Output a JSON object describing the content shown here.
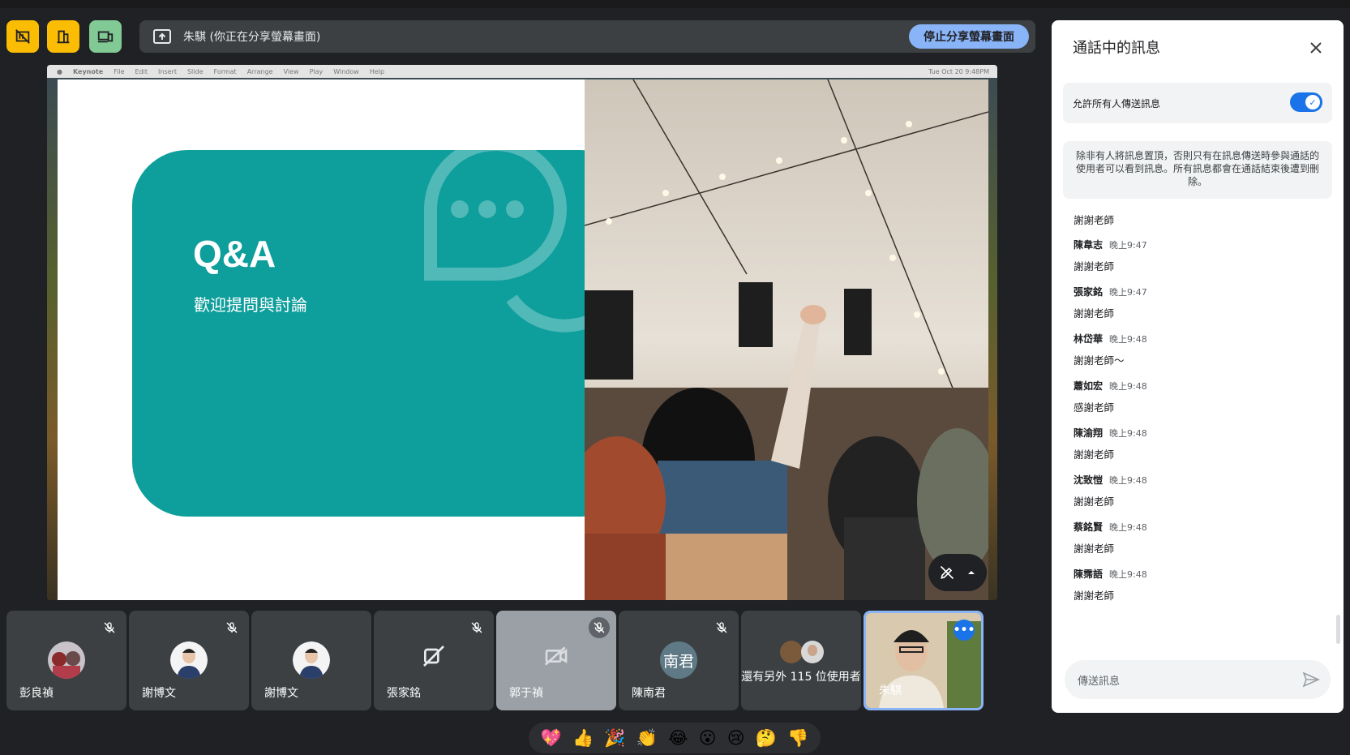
{
  "controls": {
    "share_status": "朱騏 (你正在分享螢幕畫面)",
    "stop_share_label": "停止分享螢幕畫面"
  },
  "presentation": {
    "menubar": [
      "Keynote",
      "File",
      "Edit",
      "Insert",
      "Slide",
      "Format",
      "Arrange",
      "View",
      "Play",
      "Window",
      "Help"
    ],
    "menubar_right": "Tue Oct 20  9:48PM",
    "slide_title": "Q&A",
    "slide_subtitle": "歡迎提問與討論"
  },
  "participants": [
    {
      "name": "彭良禎",
      "avatar": "photo",
      "muted": true
    },
    {
      "name": "謝博文",
      "avatar": "photo",
      "muted": true
    },
    {
      "name": "謝博文",
      "avatar": "photo",
      "muted": false
    },
    {
      "name": "張家銘",
      "avatar": "camera-off-icon",
      "muted": true
    },
    {
      "name": "郭于禎",
      "avatar": "camera-off-icon",
      "muted": true
    },
    {
      "name": "陳南君",
      "avatar_text": "南君",
      "muted": true
    },
    {
      "name": "還有另外 115 位使用者"
    },
    {
      "name": "朱騏",
      "self": true
    }
  ],
  "reactions": [
    "💖",
    "👍",
    "🎉",
    "👏",
    "😂",
    "😮",
    "😢",
    "🤔",
    "👎"
  ],
  "chat": {
    "title": "通話中的訊息",
    "allow_label": "允許所有人傳送訊息",
    "allow_enabled": true,
    "notice": "除非有人將訊息置頂，否則只有在訊息傳送時參與通話的使用者可以看到訊息。所有訊息都會在通話結束後遭到刪除。",
    "messages": [
      {
        "sender": "",
        "time": "",
        "text": "謝謝老師"
      },
      {
        "sender": "陳韋志",
        "time": "晚上9:47",
        "text": "謝謝老師"
      },
      {
        "sender": "張家銘",
        "time": "晚上9:47",
        "text": "謝謝老師"
      },
      {
        "sender": "林岱華",
        "time": "晚上9:48",
        "text": "謝謝老師～"
      },
      {
        "sender": "蕭如宏",
        "time": "晚上9:48",
        "text": "感謝老師"
      },
      {
        "sender": "陳渝翔",
        "time": "晚上9:48",
        "text": "謝謝老師"
      },
      {
        "sender": "沈致愷",
        "time": "晚上9:48",
        "text": "謝謝老師"
      },
      {
        "sender": "蔡銘賢",
        "time": "晚上9:48",
        "text": "謝謝老師"
      },
      {
        "sender": "陳霈語",
        "time": "晚上9:48",
        "text": "謝謝老師"
      }
    ],
    "input_placeholder": "傳送訊息"
  },
  "colors": {
    "accent_yellow": "#fbbc04",
    "accent_green": "#81c995",
    "stop_share_bg": "#8ab4f8",
    "slide_teal": "#0e9e9c",
    "toggle_blue": "#1a73e8"
  }
}
